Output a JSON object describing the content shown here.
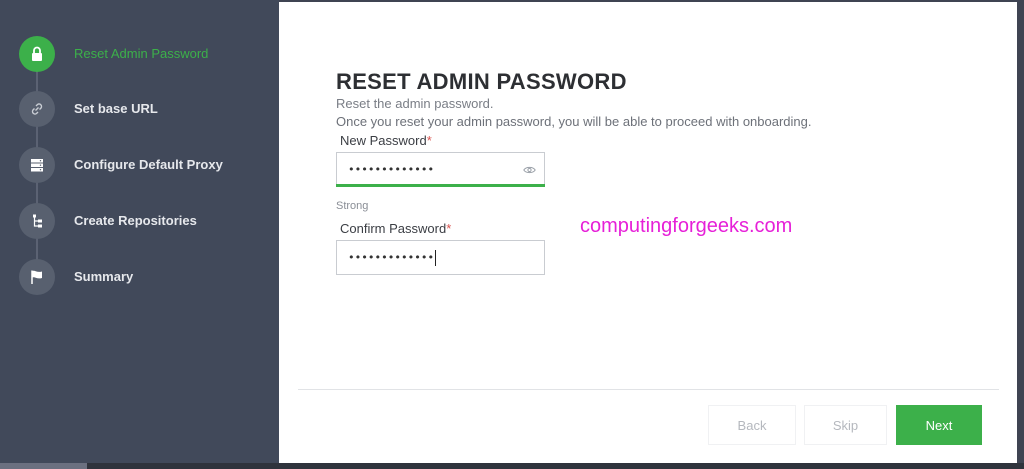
{
  "steps": [
    {
      "label": "Reset Admin Password",
      "icon": "lock-icon",
      "active": true
    },
    {
      "label": "Set base URL",
      "icon": "link-icon",
      "active": false
    },
    {
      "label": "Configure Default Proxy",
      "icon": "server-icon",
      "active": false
    },
    {
      "label": "Create Repositories",
      "icon": "tree-icon",
      "active": false
    },
    {
      "label": "Summary",
      "icon": "flag-icon",
      "active": false
    }
  ],
  "main": {
    "title": "RESET ADMIN PASSWORD",
    "subtitle": "Reset the admin password.",
    "description": "Once you reset your admin password, you will be able to proceed with onboarding.",
    "new_password": {
      "label": "New Password",
      "required_mark": "*",
      "value": "•••••••••••••"
    },
    "strength": "Strong",
    "confirm_password": {
      "label": "Confirm Password",
      "required_mark": "*",
      "value": "•••••••••••••"
    },
    "watermark": "computingforgeeks.com"
  },
  "footer": {
    "back_label": "Back",
    "skip_label": "Skip",
    "next_label": "Next"
  },
  "colors": {
    "accent": "#3cb04a",
    "sidebar": "#41495a",
    "watermark": "#e620d8"
  }
}
